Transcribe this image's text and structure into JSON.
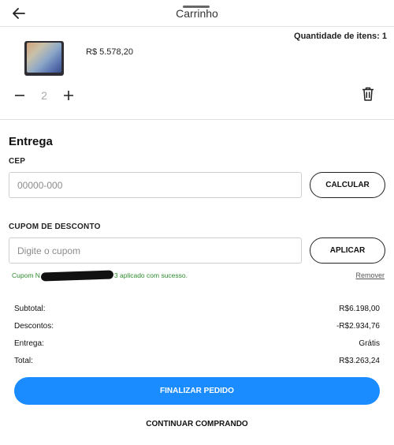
{
  "header": {
    "title": "Carrinho",
    "back_icon": "arrow-left-icon"
  },
  "cart": {
    "items_count_label": "Quantidade de itens: 1",
    "item": {
      "price": "R$ 5.578,20",
      "quantity": "2",
      "image_icon": "tablet-image"
    }
  },
  "delivery": {
    "section_title": "Entrega",
    "cep_label": "CEP",
    "cep_placeholder": "00000-000",
    "calc_button": "CALCULAR",
    "coupon_label": "CUPOM DE DESCONTO",
    "coupon_placeholder": "Digite o cupom",
    "apply_button": "APLICAR",
    "coupon_msg_prefix": "Cupom N",
    "coupon_msg_suffix": "3 aplicado com sucesso.",
    "remove_link": "Remover"
  },
  "summary": {
    "subtotal_label": "Subtotal:",
    "subtotal_value": "R$6.198,00",
    "discounts_label": "Descontos:",
    "discounts_value": "-R$2.934,76",
    "shipping_label": "Entrega:",
    "shipping_value": "Grátis",
    "total_label": "Total:",
    "total_value": "R$3.263,24"
  },
  "actions": {
    "checkout_button": "FINALIZAR PEDIDO",
    "continue_link": "CONTINUAR COMPRANDO"
  },
  "colors": {
    "primary": "#1a8cff",
    "success": "#2e8b2e"
  }
}
